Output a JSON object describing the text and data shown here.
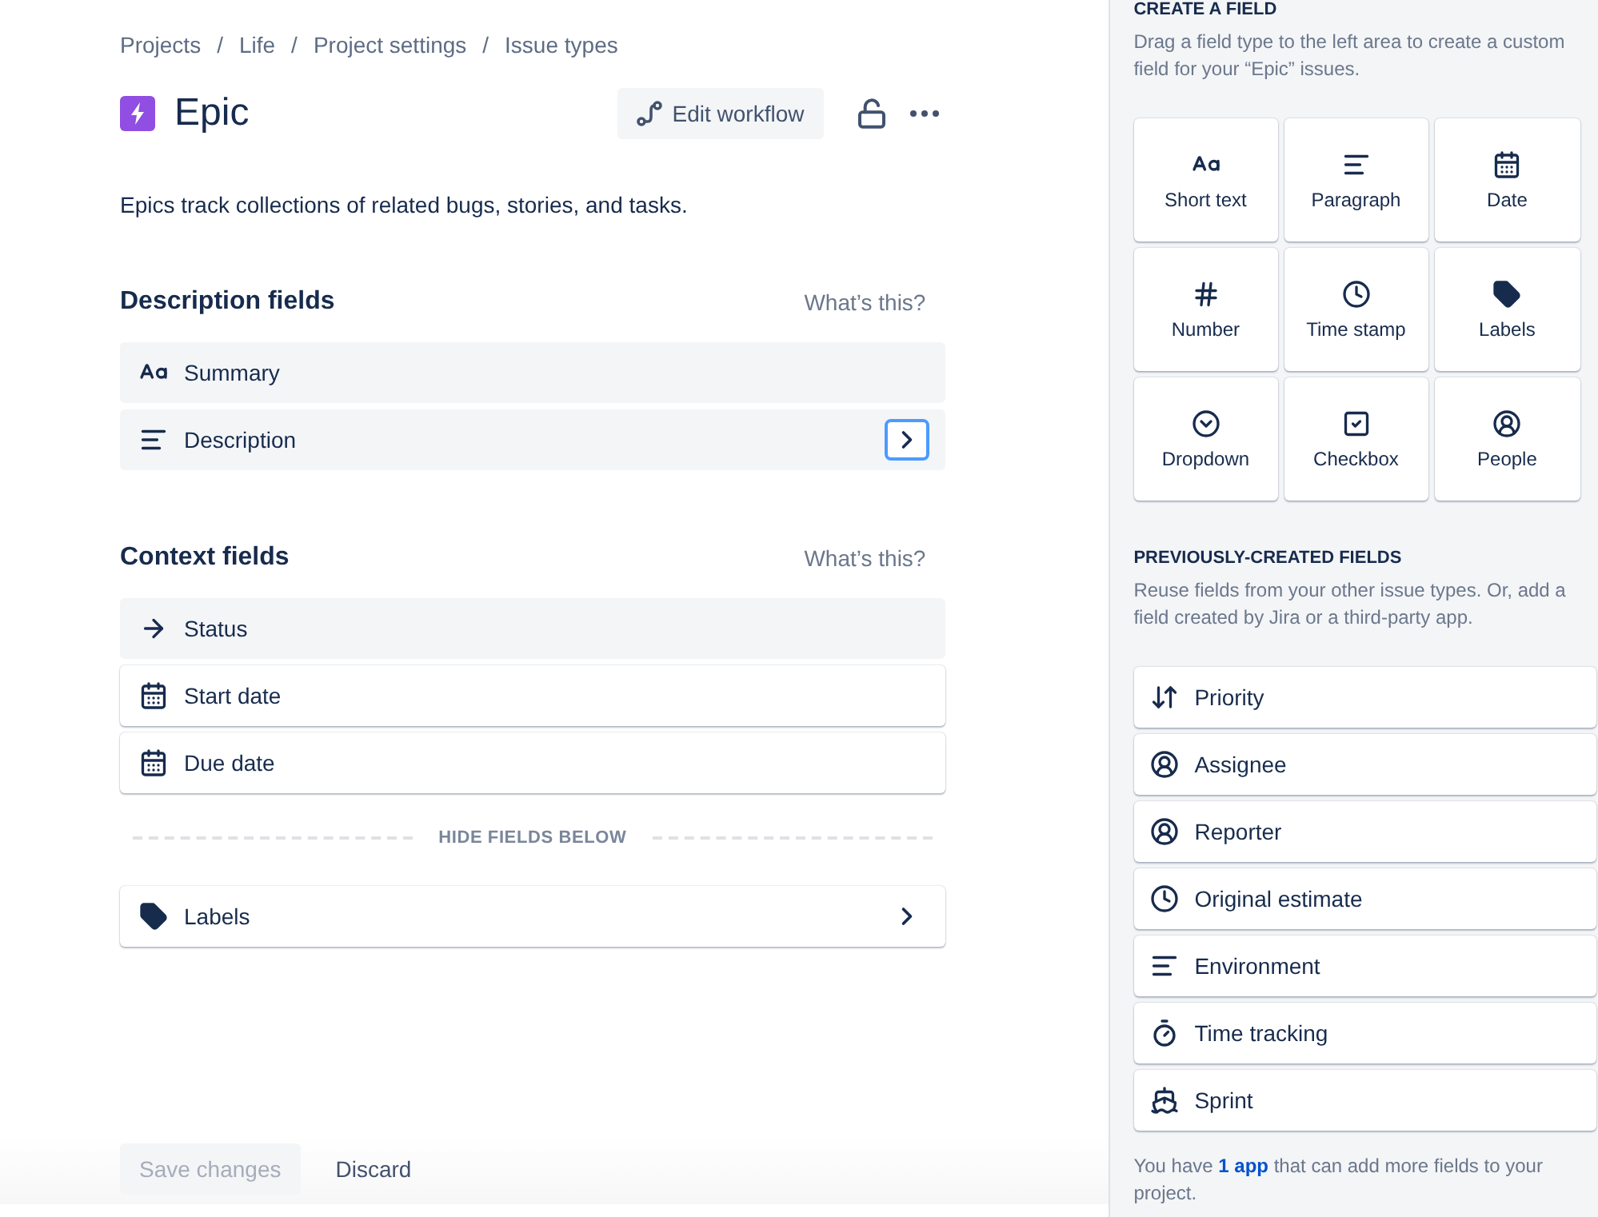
{
  "breadcrumbs": [
    {
      "label": "Projects"
    },
    {
      "separator": "/",
      "label": "Life"
    },
    {
      "separator": "/",
      "label": "Project settings"
    },
    {
      "separator": "/",
      "label": "Issue types"
    }
  ],
  "header": {
    "title": "Epic",
    "edit_workflow": "Edit workflow",
    "locked": false
  },
  "description": "Epics track collections of related bugs, stories, and tasks.",
  "sections": [
    {
      "title": "Description fields",
      "help": "What’s this?",
      "fields": [
        {
          "kind": "text",
          "label": "Summary",
          "locked": true,
          "chevron": false
        },
        {
          "kind": "paragraph",
          "label": "Description",
          "locked": true,
          "chevron": true,
          "focused": true
        }
      ]
    },
    {
      "title": "Context fields",
      "help": "What’s this?",
      "fields": [
        {
          "kind": "status",
          "label": "Status",
          "locked": true,
          "chevron": false
        },
        {
          "kind": "date",
          "label": "Start date",
          "locked": false,
          "chevron": false
        },
        {
          "kind": "date",
          "label": "Due date",
          "locked": false,
          "chevron": false
        }
      ],
      "divider": "HIDE FIELDS BELOW",
      "hidden_fields": [
        {
          "kind": "labels",
          "label": "Labels",
          "locked": false,
          "chevron": true,
          "focused": false
        }
      ]
    }
  ],
  "footer": {
    "save": "Save changes",
    "save_disabled": true,
    "discard": "Discard"
  },
  "panel": {
    "create_title": "CREATE A FIELD",
    "create_text": "Drag a field type to the left area to create a custom field for your “Epic” issues.",
    "field_types": [
      {
        "kind": "short_text",
        "label": "Short text"
      },
      {
        "kind": "paragraph",
        "label": "Paragraph"
      },
      {
        "kind": "date",
        "label": "Date"
      },
      {
        "kind": "number",
        "label": "Number"
      },
      {
        "kind": "timestamp",
        "label": "Time stamp"
      },
      {
        "kind": "labels",
        "label": "Labels"
      },
      {
        "kind": "dropdown",
        "label": "Dropdown"
      },
      {
        "kind": "checkbox",
        "label": "Checkbox"
      },
      {
        "kind": "people",
        "label": "People"
      }
    ],
    "previous_title": "PREVIOUSLY-CREATED FIELDS",
    "previous_text": "Reuse fields from your other issue types. Or, add a field created by Jira or a third-party app.",
    "previous_fields": [
      {
        "kind": "priority",
        "label": "Priority"
      },
      {
        "kind": "user",
        "label": "Assignee"
      },
      {
        "kind": "user",
        "label": "Reporter"
      },
      {
        "kind": "estimate",
        "label": "Original estimate"
      },
      {
        "kind": "paragraph",
        "label": "Environment"
      },
      {
        "kind": "timer",
        "label": "Time tracking"
      },
      {
        "kind": "sprint",
        "label": "Sprint"
      }
    ],
    "apps_note": {
      "before": "You have ",
      "link": "1 app",
      "after": " that can add more fields to your project."
    }
  }
}
